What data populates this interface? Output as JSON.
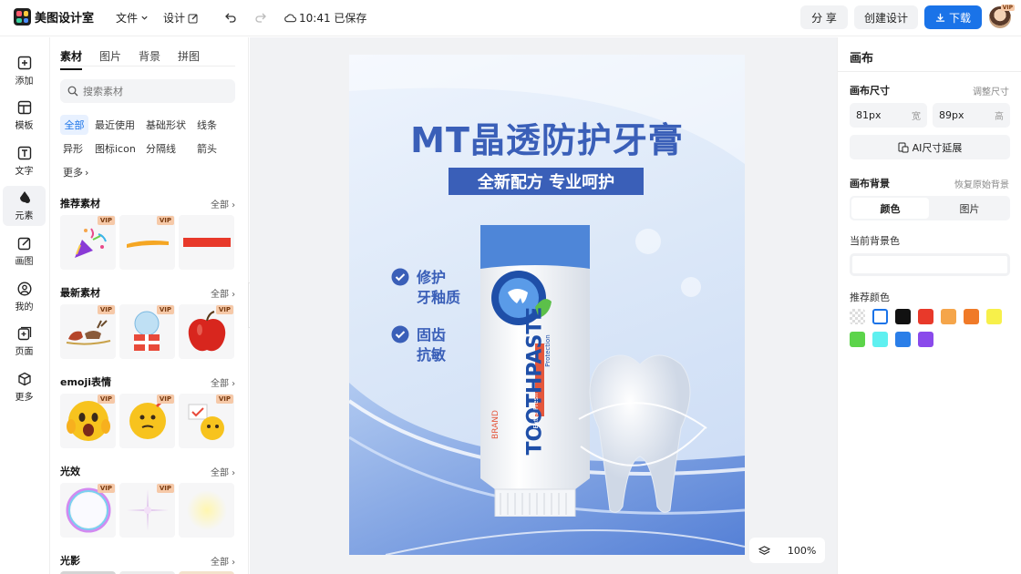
{
  "app": {
    "name": "美图设计室",
    "menu_file": "文件",
    "menu_design": "设计",
    "save_status": "10:41 已保存",
    "share": "分 享",
    "create": "创建设计",
    "download": "下载",
    "avatar_badge": "VIP"
  },
  "rail": [
    {
      "label": "添加",
      "icon": "plus-square-icon"
    },
    {
      "label": "模板",
      "icon": "template-icon"
    },
    {
      "label": "文字",
      "icon": "text-icon"
    },
    {
      "label": "元素",
      "icon": "element-icon"
    },
    {
      "label": "画图",
      "icon": "draw-icon"
    },
    {
      "label": "我的",
      "icon": "user-icon"
    },
    {
      "label": "页面",
      "icon": "page-add-icon"
    },
    {
      "label": "更多",
      "icon": "cube-icon"
    }
  ],
  "panel": {
    "tabs": [
      "素材",
      "图片",
      "背景",
      "拼图"
    ],
    "search_placeholder": "搜索素材",
    "chips": [
      "全部",
      "最近使用",
      "基础形状",
      "线条",
      "异形",
      "图标icon",
      "分隔线",
      "箭头",
      "更多"
    ],
    "all_label": "全部",
    "vip": "VIP",
    "sections": [
      {
        "title": "推荐素材"
      },
      {
        "title": "最新素材"
      },
      {
        "title": "emoji表情"
      },
      {
        "title": "光效"
      },
      {
        "title": "光影"
      }
    ]
  },
  "poster": {
    "headline": "MT晶透防护牙膏",
    "subline": "全新配方 专业呵护",
    "feature1_line1": "修护",
    "feature1_line2": "牙釉质",
    "feature2_line1": "固齿",
    "feature2_line2": "抗敏",
    "tube_brand": "BRAND",
    "tube_name": "TOOTHPASTE",
    "tube_extra": "Extra Fresh",
    "tube_protection": "Protection"
  },
  "zoom": "100%",
  "right": {
    "title": "画布",
    "size_label": "画布尺寸",
    "size_link": "调整尺寸",
    "width_value": "81px",
    "width_unit": "宽",
    "height_value": "89px",
    "height_unit": "高",
    "ai_extend": "AI尺寸延展",
    "bg_label": "画布背景",
    "bg_link": "恢复原始背景",
    "seg_color": "颜色",
    "seg_image": "图片",
    "current_bg": "当前背景色",
    "recommend": "推荐颜色",
    "swatches": [
      "transparent",
      "#ffffff",
      "#111111",
      "#e8392a",
      "#f5a54a",
      "#f07a28",
      "#f7f04a",
      "#5cd44a",
      "#5ef0f0",
      "#2a7ee8",
      "#8a4aeb"
    ]
  },
  "colors": {
    "accent": "#1a73e8",
    "poster_blue": "#3a5fb8"
  }
}
